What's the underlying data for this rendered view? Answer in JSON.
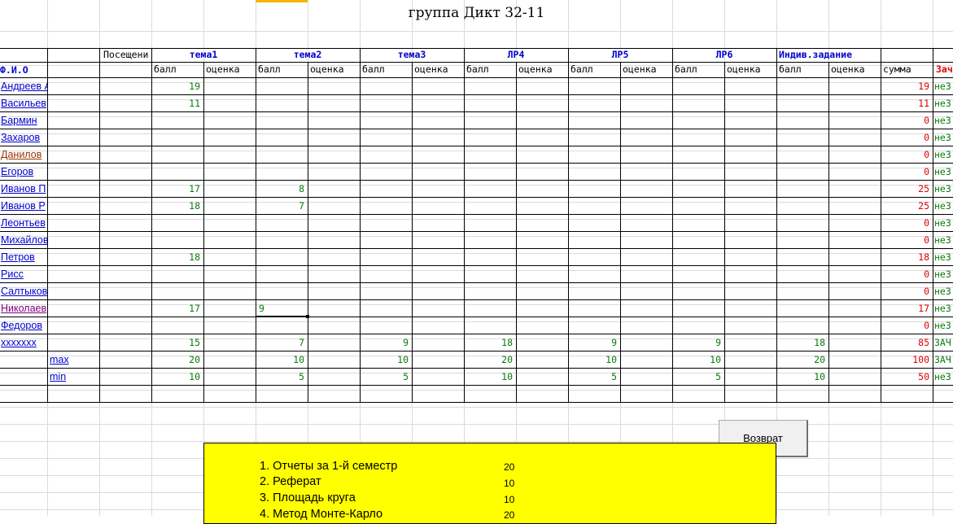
{
  "title": "группа Дикт 32-11",
  "headers": {
    "visits": "Посещени",
    "fio": "Ф.И.О",
    "topics": [
      "тема1",
      "тема2",
      "тема3",
      "ЛР4",
      "ЛР5",
      "ЛР6",
      "Индив.задание"
    ],
    "score": "балл",
    "grade": "оценка",
    "sum": "сумма",
    "result": "Зач"
  },
  "rows": [
    {
      "name": "Андреев А",
      "scores": [
        "19",
        "",
        "",
        "",
        "",
        "",
        ""
      ],
      "sum": "19",
      "result": "неЗ",
      "style": ""
    },
    {
      "name": "Васильев",
      "scores": [
        "11",
        "",
        "",
        "",
        "",
        "",
        ""
      ],
      "sum": "11",
      "result": "неЗ",
      "style": ""
    },
    {
      "name": "Бармин",
      "scores": [
        "",
        "",
        "",
        "",
        "",
        "",
        ""
      ],
      "sum": "0",
      "result": "неЗ",
      "style": ""
    },
    {
      "name": "Захаров",
      "scores": [
        "",
        "",
        "",
        "",
        "",
        "",
        ""
      ],
      "sum": "0",
      "result": "неЗ",
      "style": ""
    },
    {
      "name": "Данилов",
      "scores": [
        "",
        "",
        "",
        "",
        "",
        "",
        ""
      ],
      "sum": "0",
      "result": "неЗ",
      "style": "visited"
    },
    {
      "name": "Егоров",
      "scores": [
        "",
        "",
        "",
        "",
        "",
        "",
        ""
      ],
      "sum": "0",
      "result": "неЗ",
      "style": ""
    },
    {
      "name": "Иванов П",
      "scores": [
        "17",
        "8",
        "",
        "",
        "",
        "",
        ""
      ],
      "sum": "25",
      "result": "неЗ",
      "style": ""
    },
    {
      "name": "Иванов Р",
      "scores": [
        "18",
        "7",
        "",
        "",
        "",
        "",
        ""
      ],
      "sum": "25",
      "result": "неЗ",
      "style": ""
    },
    {
      "name": "Леонтьев",
      "scores": [
        "",
        "",
        "",
        "",
        "",
        "",
        ""
      ],
      "sum": "0",
      "result": "неЗ",
      "style": ""
    },
    {
      "name": "Михайлов",
      "scores": [
        "",
        "",
        "",
        "",
        "",
        "",
        ""
      ],
      "sum": "0",
      "result": "неЗ",
      "style": ""
    },
    {
      "name": "Петров",
      "scores": [
        "18",
        "",
        "",
        "",
        "",
        "",
        ""
      ],
      "sum": "18",
      "result": "неЗ",
      "style": ""
    },
    {
      "name": "Рисс",
      "scores": [
        "",
        "",
        "",
        "",
        "",
        "",
        ""
      ],
      "sum": "0",
      "result": "неЗ",
      "style": ""
    },
    {
      "name": "Салтыкова",
      "scores": [
        "",
        "",
        "",
        "",
        "",
        "",
        ""
      ],
      "sum": "0",
      "result": "неЗ",
      "style": ""
    },
    {
      "name": "Николаев",
      "scores": [
        "17",
        "",
        "",
        "",
        "",
        "",
        ""
      ],
      "sum": "17",
      "result": "неЗ",
      "style": "purple",
      "selected_value": "9"
    },
    {
      "name": "Федоров",
      "scores": [
        "",
        "",
        "",
        "",
        "",
        "",
        ""
      ],
      "sum": "0",
      "result": "неЗ",
      "style": ""
    },
    {
      "name": "xxxxxxx",
      "scores": [
        "15",
        "7",
        "9",
        "18",
        "9",
        "9",
        "18"
      ],
      "sum": "85",
      "result": "ЗАЧ",
      "style": ""
    },
    {
      "name": "max",
      "scores": [
        "20",
        "10",
        "10",
        "20",
        "10",
        "10",
        "20"
      ],
      "sum": "100",
      "result": "ЗАЧ",
      "style": "",
      "sub": true
    },
    {
      "name": "min",
      "scores": [
        "10",
        "5",
        "5",
        "10",
        "5",
        "5",
        "10"
      ],
      "sum": "50",
      "result": "неЗ",
      "style": "",
      "sub": true
    }
  ],
  "return_button": "Возврат",
  "list": [
    {
      "label": "1. Отчеты за 1-й семестр",
      "value": "20"
    },
    {
      "label": "2. Реферат",
      "value": "10"
    },
    {
      "label": "3. Площадь круга",
      "value": "10"
    },
    {
      "label": "4. Метод Монте-Карло",
      "value": "20"
    }
  ]
}
